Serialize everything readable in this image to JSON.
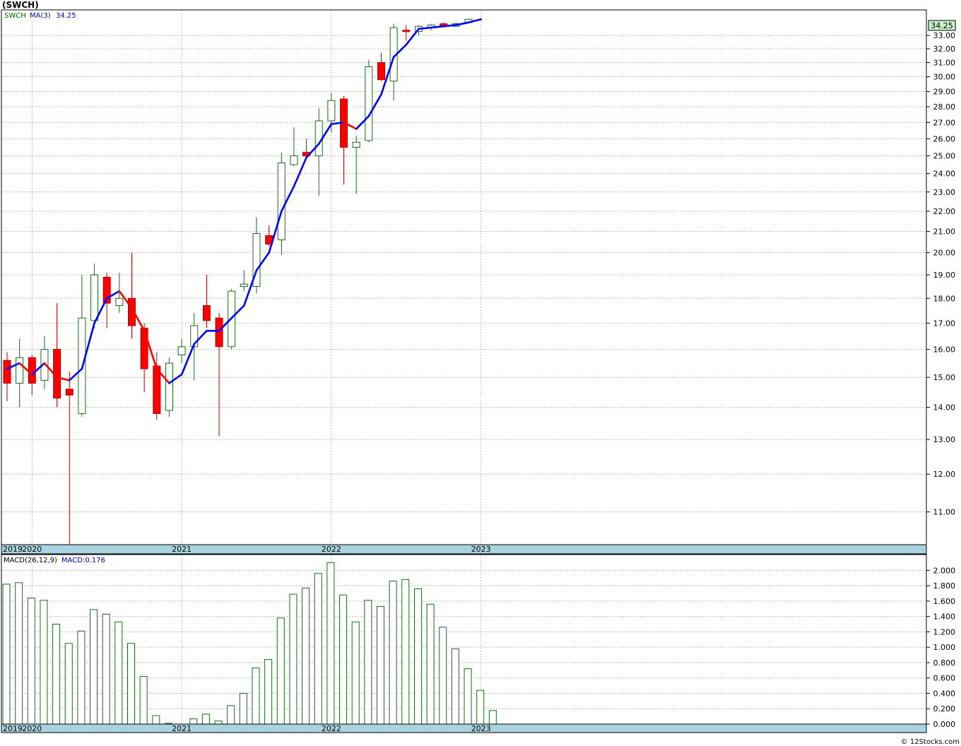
{
  "header": {
    "title": "(SWCH)",
    "footer": "© 12Stocks.com"
  },
  "colors": {
    "up_body": "#ffffff",
    "up_stroke": "#1c6a1c",
    "down_body": "#ff0000",
    "down_stroke": "#b00000",
    "ma_up": "#0000ff",
    "ma_down": "#ff0000",
    "last_bg": "#c8f2c8",
    "band": "#a9d4df",
    "macd": "#1c6a1c"
  },
  "chart_data": [
    {
      "type": "candlestick",
      "ticker": "SWCH",
      "legend": {
        "symbol": "SWCH",
        "ma_label": "MA(3)",
        "ma_value": "34.25"
      },
      "last_price_label": "34.25",
      "y_scale": "log",
      "ylim": [
        10.2,
        35.0
      ],
      "y_ticks": [
        "11.00",
        "12.00",
        "13.00",
        "14.00",
        "15.00",
        "16.00",
        "17.00",
        "18.00",
        "19.00",
        "20.00",
        "21.00",
        "22.00",
        "23.00",
        "24.00",
        "25.00",
        "26.00",
        "27.00",
        "28.00",
        "29.00",
        "30.00",
        "31.00",
        "32.00",
        "33.00"
      ],
      "x_labels": [
        "2019",
        "2020",
        "2021",
        "2022",
        "2023"
      ],
      "candles": [
        {
          "date": "2019-11",
          "open": 15.6,
          "high": 15.9,
          "low": 14.2,
          "close": 14.8
        },
        {
          "date": "2019-12",
          "open": 14.8,
          "high": 16.4,
          "low": 14.0,
          "close": 15.7
        },
        {
          "date": "2020-01",
          "open": 15.7,
          "high": 15.8,
          "low": 14.4,
          "close": 14.8
        },
        {
          "date": "2020-02",
          "open": 14.9,
          "high": 16.5,
          "low": 14.6,
          "close": 16.0
        },
        {
          "date": "2020-03",
          "open": 16.0,
          "high": 17.8,
          "low": 14.0,
          "close": 14.3
        },
        {
          "date": "2020-04",
          "open": 14.6,
          "high": 15.2,
          "low": 8.6,
          "close": 14.4
        },
        {
          "date": "2020-05",
          "open": 13.8,
          "high": 19.0,
          "low": 13.7,
          "close": 17.2
        },
        {
          "date": "2020-06",
          "open": 17.1,
          "high": 19.5,
          "low": 16.8,
          "close": 19.0
        },
        {
          "date": "2020-07",
          "open": 18.9,
          "high": 19.1,
          "low": 16.8,
          "close": 17.8
        },
        {
          "date": "2020-08",
          "open": 17.7,
          "high": 19.1,
          "low": 17.4,
          "close": 18.0
        },
        {
          "date": "2020-09",
          "open": 18.0,
          "high": 20.0,
          "low": 16.4,
          "close": 16.9
        },
        {
          "date": "2020-10",
          "open": 16.8,
          "high": 17.0,
          "low": 14.5,
          "close": 15.3
        },
        {
          "date": "2020-11",
          "open": 15.4,
          "high": 15.9,
          "low": 13.6,
          "close": 13.8
        },
        {
          "date": "2020-12",
          "open": 13.9,
          "high": 15.7,
          "low": 13.7,
          "close": 15.5
        },
        {
          "date": "2021-01",
          "open": 15.8,
          "high": 16.4,
          "low": 15.5,
          "close": 16.1
        },
        {
          "date": "2021-02",
          "open": 16.1,
          "high": 17.4,
          "low": 14.9,
          "close": 16.9
        },
        {
          "date": "2021-03",
          "open": 17.7,
          "high": 19.0,
          "low": 16.8,
          "close": 17.1
        },
        {
          "date": "2021-04",
          "open": 17.2,
          "high": 17.4,
          "low": 13.1,
          "close": 16.1
        },
        {
          "date": "2021-05",
          "open": 16.1,
          "high": 18.4,
          "low": 16.0,
          "close": 18.3
        },
        {
          "date": "2021-06",
          "open": 18.5,
          "high": 19.2,
          "low": 18.3,
          "close": 18.6
        },
        {
          "date": "2021-07",
          "open": 18.5,
          "high": 21.7,
          "low": 18.2,
          "close": 20.9
        },
        {
          "date": "2021-08",
          "open": 20.8,
          "high": 21.3,
          "low": 20.3,
          "close": 20.4
        },
        {
          "date": "2021-09",
          "open": 20.6,
          "high": 25.2,
          "low": 19.9,
          "close": 24.6
        },
        {
          "date": "2021-10",
          "open": 24.5,
          "high": 26.7,
          "low": 24.4,
          "close": 25.0
        },
        {
          "date": "2021-11",
          "open": 25.2,
          "high": 26.0,
          "low": 24.9,
          "close": 25.0
        },
        {
          "date": "2021-12",
          "open": 25.0,
          "high": 27.9,
          "low": 22.8,
          "close": 27.1
        },
        {
          "date": "2022-01",
          "open": 27.1,
          "high": 28.9,
          "low": 26.4,
          "close": 28.4
        },
        {
          "date": "2022-02",
          "open": 28.5,
          "high": 28.7,
          "low": 23.4,
          "close": 25.5
        },
        {
          "date": "2022-03",
          "open": 25.5,
          "high": 26.2,
          "low": 22.9,
          "close": 25.8
        },
        {
          "date": "2022-04",
          "open": 25.9,
          "high": 31.2,
          "low": 25.8,
          "close": 30.7
        },
        {
          "date": "2022-05",
          "open": 31.0,
          "high": 31.7,
          "low": 29.7,
          "close": 29.8
        },
        {
          "date": "2022-06",
          "open": 29.7,
          "high": 33.9,
          "low": 28.4,
          "close": 33.6
        },
        {
          "date": "2022-07",
          "open": 33.4,
          "high": 33.8,
          "low": 32.6,
          "close": 33.3
        },
        {
          "date": "2022-08",
          "open": 33.3,
          "high": 33.8,
          "low": 33.0,
          "close": 33.7
        },
        {
          "date": "2022-09",
          "open": 33.6,
          "high": 33.9,
          "low": 33.4,
          "close": 33.8
        },
        {
          "date": "2022-10",
          "open": 33.9,
          "high": 34.0,
          "low": 33.6,
          "close": 33.7
        },
        {
          "date": "2022-11",
          "open": 33.7,
          "high": 34.0,
          "low": 33.7,
          "close": 33.9
        },
        {
          "date": "2022-12",
          "open": 34.0,
          "high": 34.3,
          "low": 34.0,
          "close": 34.25
        }
      ],
      "ma3": [
        15.3,
        15.5,
        15.1,
        15.5,
        15.0,
        14.9,
        15.3,
        17.0,
        18.0,
        18.3,
        17.6,
        16.7,
        15.3,
        14.8,
        15.1,
        16.2,
        16.7,
        16.7,
        17.2,
        17.7,
        19.2,
        20.0,
        22.0,
        23.3,
        24.9,
        25.7,
        26.9,
        27.0,
        26.6,
        27.4,
        28.8,
        31.4,
        32.3,
        33.5,
        33.6,
        33.7,
        33.8,
        34.0
      ],
      "ma3_up": [
        false,
        true,
        false,
        true,
        false,
        false,
        true,
        true,
        true,
        true,
        false,
        false,
        false,
        false,
        true,
        true,
        true,
        true,
        true,
        true,
        true,
        true,
        true,
        true,
        true,
        true,
        true,
        true,
        false,
        true,
        true,
        true,
        true,
        true,
        true,
        true,
        true,
        true
      ],
      "ma3_last_date": "2023-01",
      "ma3_last": 34.25
    },
    {
      "type": "bar",
      "title": "MACD(26,12,9)",
      "legend_value": "MACD:0.176",
      "ylim": [
        0,
        2.15
      ],
      "y_ticks": [
        "0.000",
        "0.200",
        "0.400",
        "0.600",
        "0.800",
        "1.000",
        "1.200",
        "1.400",
        "1.600",
        "1.800",
        "2.000"
      ],
      "x_labels": [
        "2019",
        "2020",
        "2021",
        "2022",
        "2023"
      ],
      "values": [
        1.82,
        1.84,
        1.64,
        1.61,
        1.3,
        1.05,
        1.21,
        1.49,
        1.43,
        1.33,
        1.05,
        0.62,
        0.11,
        0.01,
        0.0,
        0.07,
        0.13,
        0.04,
        0.24,
        0.4,
        0.73,
        0.84,
        1.38,
        1.69,
        1.77,
        1.96,
        2.1,
        1.68,
        1.33,
        1.61,
        1.53,
        1.86,
        1.88,
        1.76,
        1.56,
        1.26,
        0.98,
        0.72,
        0.44,
        0.176
      ]
    }
  ]
}
